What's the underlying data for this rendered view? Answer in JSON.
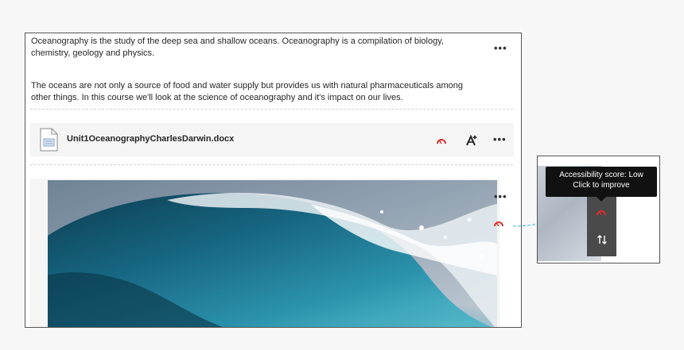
{
  "content": {
    "paragraph1": "Oceanography is the study of the deep sea and shallow oceans. Oceanography is a compilation of biology, chemistry, geology and physics.",
    "paragraph2": "The oceans are not only a source of food and water supply but provides us with natural pharmaceuticals among other things. In this course we'll look at the science of oceanography and it's impact on our lives.",
    "more_label": "•••"
  },
  "file": {
    "name": "Unit1OceanographyCharlesDarwin.docx",
    "icon": "document-icon"
  },
  "accessibility": {
    "tooltip_line1": "Accessibility score: Low",
    "tooltip_line2": "Click to improve",
    "score_color": "#e0302b"
  },
  "colors": {
    "accent_arrow": "#5bbfe6",
    "score_low": "#e0302b"
  }
}
